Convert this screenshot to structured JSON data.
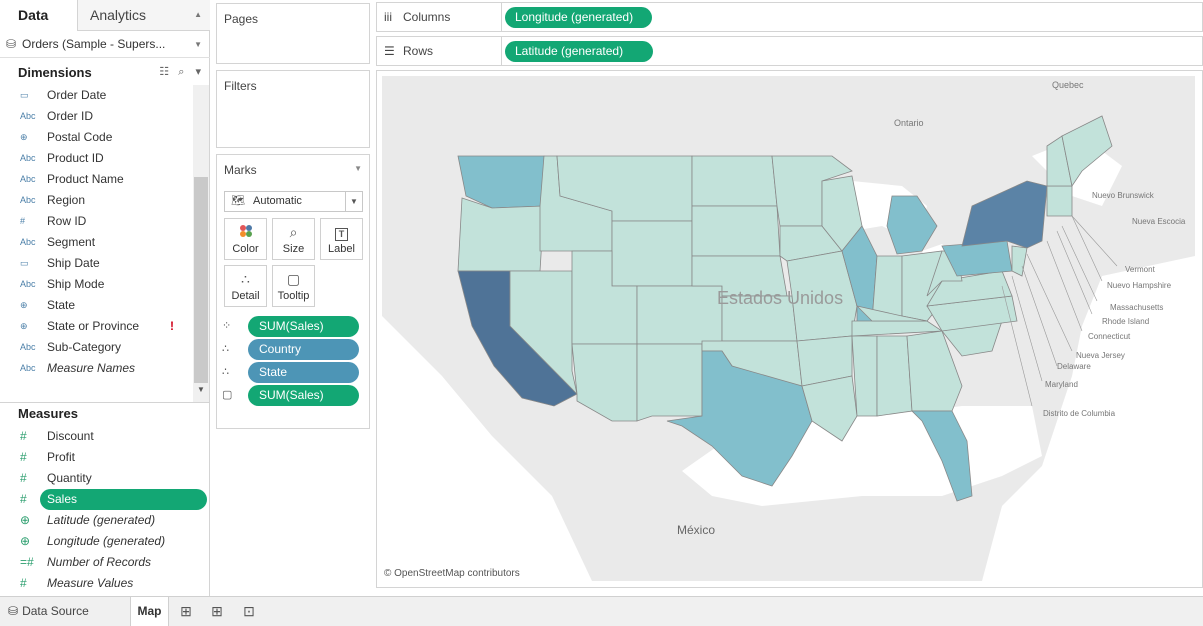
{
  "data_pane": {
    "tab_data": "Data",
    "tab_analytics": "Analytics",
    "datasource": "Orders (Sample - Supers...",
    "dimensions_header": "Dimensions",
    "dimensions": [
      {
        "icon": "calendar-icon",
        "glyph": "▭",
        "label": "Order Date"
      },
      {
        "icon": "abc-icon",
        "glyph": "Abc",
        "label": "Order ID"
      },
      {
        "icon": "globe-icon",
        "glyph": "⊕",
        "label": "Postal Code"
      },
      {
        "icon": "abc-icon",
        "glyph": "Abc",
        "label": "Product ID"
      },
      {
        "icon": "abc-icon",
        "glyph": "Abc",
        "label": "Product Name"
      },
      {
        "icon": "abc-icon",
        "glyph": "Abc",
        "label": "Region"
      },
      {
        "icon": "number-icon",
        "glyph": "#",
        "label": "Row ID"
      },
      {
        "icon": "abc-icon",
        "glyph": "Abc",
        "label": "Segment"
      },
      {
        "icon": "calendar-icon",
        "glyph": "▭",
        "label": "Ship Date"
      },
      {
        "icon": "abc-icon",
        "glyph": "Abc",
        "label": "Ship Mode"
      },
      {
        "icon": "globe-icon",
        "glyph": "⊕",
        "label": "State"
      },
      {
        "icon": "globe-icon",
        "glyph": "⊕",
        "label": "State or Province",
        "warning": "!"
      },
      {
        "icon": "abc-icon",
        "glyph": "Abc",
        "label": "Sub-Category"
      },
      {
        "icon": "abc-icon",
        "glyph": "Abc",
        "label": "Measure Names",
        "italic": true
      }
    ],
    "measures_header": "Measures",
    "measures": [
      {
        "icon": "number-icon",
        "glyph": "#",
        "label": "Discount"
      },
      {
        "icon": "number-icon",
        "glyph": "#",
        "label": "Profit"
      },
      {
        "icon": "number-icon",
        "glyph": "#",
        "label": "Quantity"
      },
      {
        "icon": "number-icon",
        "glyph": "#",
        "label": "Sales",
        "selected": true
      },
      {
        "icon": "globe-icon",
        "glyph": "⊕",
        "label": "Latitude (generated)",
        "italic": true
      },
      {
        "icon": "globe-icon",
        "glyph": "⊕",
        "label": "Longitude (generated)",
        "italic": true
      },
      {
        "icon": "number-icon",
        "glyph": "=#",
        "label": "Number of Records",
        "italic": true
      },
      {
        "icon": "number-icon",
        "glyph": "#",
        "label": "Measure Values",
        "italic": true
      }
    ]
  },
  "cards": {
    "pages": "Pages",
    "filters": "Filters",
    "marks": "Marks",
    "mark_type": "Automatic",
    "buttons": [
      {
        "name": "color",
        "label": "Color",
        "glyph": "⁘"
      },
      {
        "name": "size",
        "label": "Size",
        "glyph": "⌕"
      },
      {
        "name": "label",
        "label": "Label",
        "glyph": "T"
      },
      {
        "name": "detail",
        "label": "Detail",
        "glyph": "∴"
      },
      {
        "name": "tooltip",
        "label": "Tooltip",
        "glyph": "▢"
      }
    ],
    "mark_pills": [
      {
        "icon": "color-icon",
        "glyph": "⁘",
        "label": "SUM(Sales)",
        "color": "green"
      },
      {
        "icon": "detail-icon",
        "glyph": "∴",
        "label": "Country",
        "color": "blue"
      },
      {
        "icon": "detail-icon",
        "glyph": "∴",
        "label": "State",
        "color": "blue"
      },
      {
        "icon": "tooltip-icon",
        "glyph": "▢",
        "label": "SUM(Sales)",
        "color": "green"
      }
    ]
  },
  "shelves": {
    "columns_label": "Columns",
    "columns_pill": "Longitude (generated)",
    "rows_label": "Rows",
    "rows_pill": "Latitude (generated)"
  },
  "map": {
    "attribution": "© OpenStreetMap contributors",
    "colors": {
      "light": "#c2e2da",
      "mid": "#82bfcc",
      "dark": "#4f7397",
      "darker": "#5b83a6",
      "background": "#eaeaea",
      "water": "#ffffff"
    },
    "place_labels": {
      "quebec": "Quebec",
      "ontario": "Ontario",
      "nuevo_brunswick": "Nuevo Brunswick",
      "nueva_escocia": "Nueva Escocia",
      "estados_unidos": "Estados Unidos",
      "mexico": "México"
    },
    "callouts": [
      "Vermont",
      "Nuevo Hampshire",
      "Massachusetts",
      "Rhode Island",
      "Connecticut",
      "Nueva Jersey",
      "Delaware",
      "Maryland",
      "Distrito de Columbia"
    ]
  },
  "bottom_bar": {
    "data_source": "Data Source",
    "sheet": "Map"
  }
}
